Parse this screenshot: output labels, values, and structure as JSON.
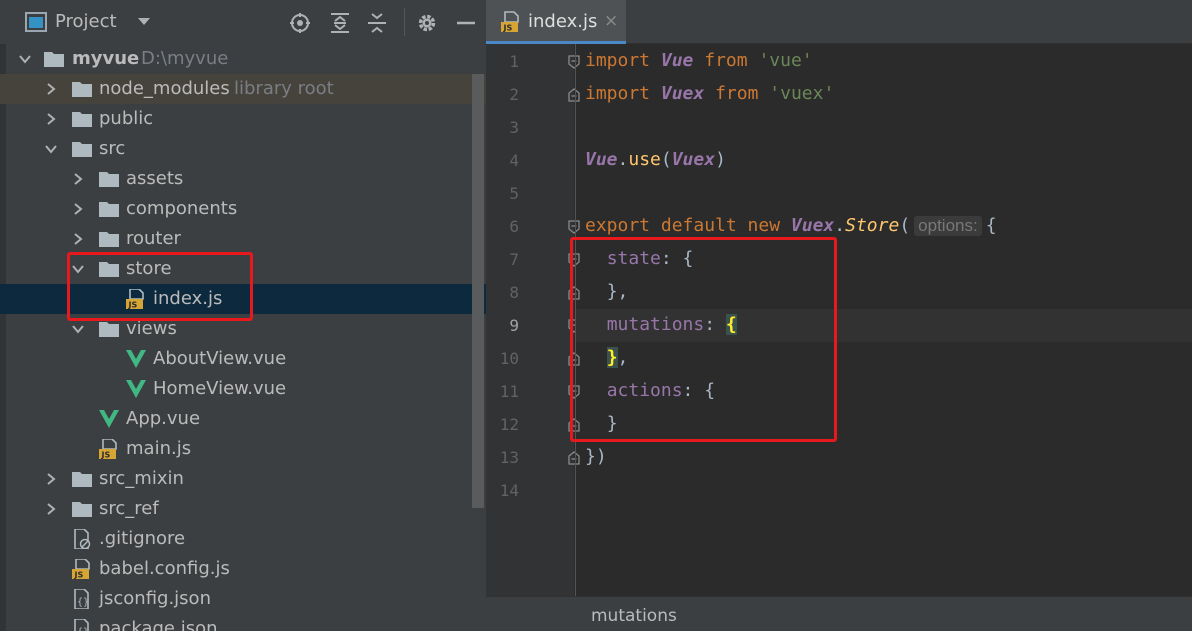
{
  "project_panel": {
    "title": "Project",
    "tree": [
      {
        "label": "myvue",
        "hint": "D:\\myvue"
      },
      {
        "label": "node_modules",
        "hint": "library root"
      },
      {
        "label": "public"
      },
      {
        "label": "src"
      },
      {
        "label": "assets"
      },
      {
        "label": "components"
      },
      {
        "label": "router"
      },
      {
        "label": "store"
      },
      {
        "label": "index.js"
      },
      {
        "label": "views"
      },
      {
        "label": "AboutView.vue"
      },
      {
        "label": "HomeView.vue"
      },
      {
        "label": "App.vue"
      },
      {
        "label": "main.js"
      },
      {
        "label": "src_mixin"
      },
      {
        "label": "src_ref"
      },
      {
        "label": ".gitignore"
      },
      {
        "label": "babel.config.js"
      },
      {
        "label": "jsconfig.json"
      },
      {
        "label": "package.json"
      }
    ]
  },
  "editor": {
    "tab": {
      "label": "index.js",
      "close": "×",
      "icon_text": "JS"
    },
    "line_numbers": [
      "1",
      "2",
      "3",
      "4",
      "5",
      "6",
      "7",
      "8",
      "9",
      "10",
      "11",
      "12",
      "13",
      "14"
    ],
    "code": {
      "l1": {
        "kw": "import",
        "cls": "Vue",
        "kw2": "from",
        "str": "'vue'"
      },
      "l2": {
        "kw": "import",
        "cls": "Vuex",
        "kw2": "from",
        "str": "'vuex'"
      },
      "l4": {
        "cls": "Vue",
        "dot": ".",
        "fn": "use",
        "open": "(",
        "arg": "Vuex",
        "close": ")"
      },
      "l6": {
        "kw": "export default new",
        "cls": "Vuex",
        "dot": ".",
        "fn": "Store",
        "open": "(",
        "hint": "options:",
        "brace": "{"
      },
      "l7": {
        "prop": "state",
        "rest": ": {"
      },
      "l8": {
        "text": "},"
      },
      "l9": {
        "prop": "mutations",
        "rest": ": ",
        "brace": "{"
      },
      "l10": {
        "brace": "}",
        "rest": ","
      },
      "l11": {
        "prop": "actions",
        "rest": ": {"
      },
      "l12": {
        "text": "}"
      },
      "l13": {
        "text": "})"
      }
    },
    "breadcrumb": "mutations"
  },
  "colors": {
    "panel_bg": "#3c3f41",
    "editor_bg": "#2b2b2b",
    "selection": "#0d293e",
    "annotation": "#e8191c",
    "vue_green": "#41b883"
  }
}
